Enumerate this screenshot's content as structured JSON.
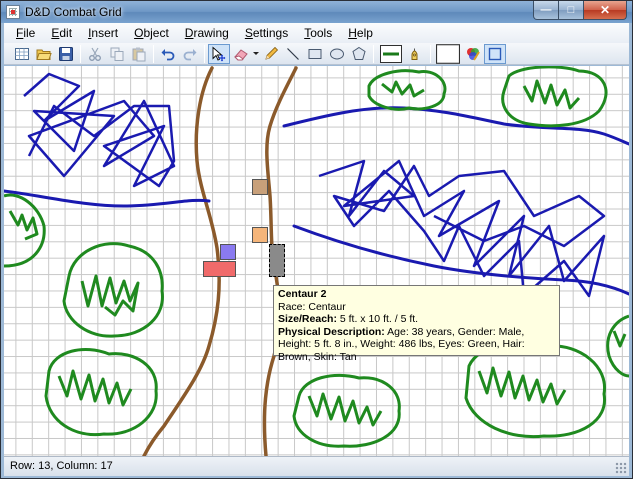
{
  "window": {
    "title": "D&D Combat Grid",
    "minimize_glyph": "—",
    "maximize_glyph": "□",
    "close_glyph": "✕"
  },
  "menu": [
    {
      "name": "File",
      "key": "F",
      "rest": "ile"
    },
    {
      "name": "Edit",
      "key": "E",
      "rest": "dit"
    },
    {
      "name": "Insert",
      "key": "I",
      "rest": "nsert"
    },
    {
      "name": "Object",
      "key": "O",
      "rest": "bject"
    },
    {
      "name": "Drawing",
      "key": "D",
      "rest": "rawing"
    },
    {
      "name": "Settings",
      "key": "S",
      "rest": "ettings"
    },
    {
      "name": "Tools",
      "key": "T",
      "rest": "ools"
    },
    {
      "name": "Help",
      "key": "H",
      "rest": "elp"
    }
  ],
  "toolbar": {
    "icons": [
      "new-grid-icon",
      "open-folder-icon",
      "save-disk-icon",
      "cut-icon",
      "copy-icon",
      "paste-icon",
      "undo-icon",
      "redo-icon",
      "select-move-icon",
      "eraser-icon",
      "pencil-icon",
      "line-icon",
      "rectangle-icon",
      "ellipse-icon",
      "polygon-icon",
      "line-thickness-icon",
      "fill-icon",
      "color-picker-icon",
      "fill-color-swatch",
      "selection-box-icon"
    ],
    "active_tool": "select-move-icon",
    "line_color": "#1a7a1a",
    "fill_color": "#ffffff"
  },
  "map": {
    "river_color": "#1a1ab0",
    "path_color": "#8b5a2b",
    "tree_color": "#1f8a1f",
    "grid_color": "#c8c8c8",
    "tokens": [
      {
        "name": "token-tan",
        "color": "#c8a07a"
      },
      {
        "name": "token-orange",
        "color": "#f5b57a"
      },
      {
        "name": "token-purple",
        "color": "#8a7af0"
      },
      {
        "name": "token-red",
        "color": "#f06a6a"
      },
      {
        "name": "token-gray-selected",
        "color": "#8a8a8a"
      }
    ]
  },
  "tooltip": {
    "title": "Centaur 2",
    "race_label": "Race:",
    "race_value": "Centaur",
    "size_label": "Size/Reach:",
    "size_value": "5 ft. x 10 ft. / 5 ft.",
    "phys_label": "Physical Description:",
    "phys_value": "Age: 38 years, Gender: Male, Height: 5 ft. 8 in., Weight: 486 lbs, Eyes: Green, Hair: Brown, Skin: Tan"
  },
  "status": {
    "text": "Row: 13, Column: 17"
  }
}
